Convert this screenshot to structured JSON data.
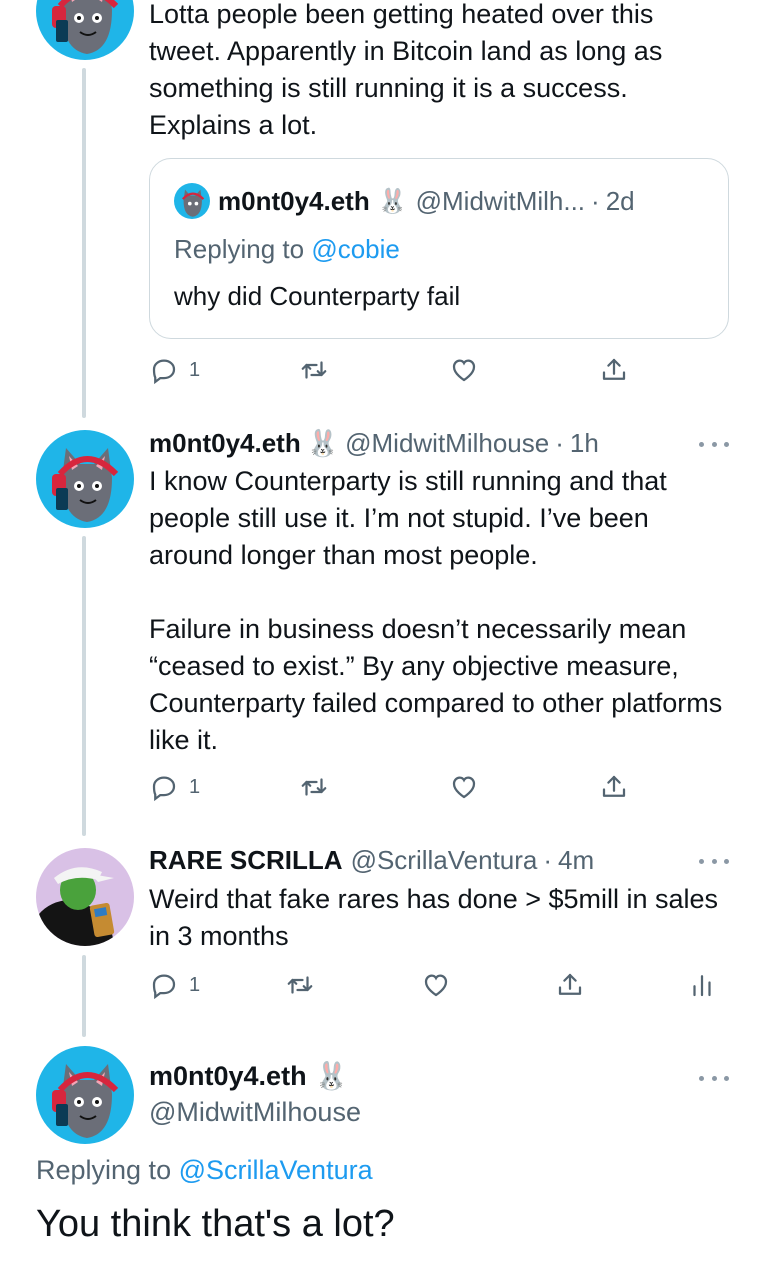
{
  "tweet1": {
    "text": "Lotta people been getting heated over this tweet. Apparently in Bitcoin land as long as something is still running it is a success. Explains a lot.",
    "quote": {
      "name": "m0nt0y4.eth",
      "badge": "🐰",
      "handle": "@MidwitMilh...",
      "sep": "·",
      "time": "2d",
      "replying_prefix": "Replying to ",
      "replying_handle": "@cobie",
      "text": "why did Counterparty fail"
    },
    "actions": {
      "reply_count": "1",
      "icons": [
        "reply-icon",
        "retweet-icon",
        "like-icon",
        "share-icon"
      ]
    }
  },
  "tweet2": {
    "name": "m0nt0y4.eth",
    "badge": "🐰",
    "handle": "@MidwitMilhouse",
    "sep": "·",
    "time": "1h",
    "paragraph1": "I know Counterparty is still running and that people still use it. I’m not stupid. I’ve been around longer than most people.",
    "paragraph2": "Failure in business doesn’t necessarily mean “ceased to exist.” By any objective measure, Counterparty failed compared to other platforms like it.",
    "actions": {
      "reply_count": "1"
    }
  },
  "tweet3": {
    "name": "RARE SCRILLA",
    "handle": "@ScrillaVentura",
    "sep": "·",
    "time": "4m",
    "text": "Weird that fake rares has done > $5mill in sales in 3 months",
    "actions": {
      "reply_count": "1"
    }
  },
  "tweet4": {
    "name": "m0nt0y4.eth",
    "badge": "🐰",
    "handle": "@MidwitMilhouse",
    "replying_prefix": "Replying to ",
    "replying_handle": "@ScrillaVentura",
    "text": "You think that's a lot?"
  },
  "colors": {
    "accent": "#1d9bf0",
    "muted": "#536471",
    "thread_line": "#cfd9de",
    "avatar_bg": "#1fb5e8"
  }
}
